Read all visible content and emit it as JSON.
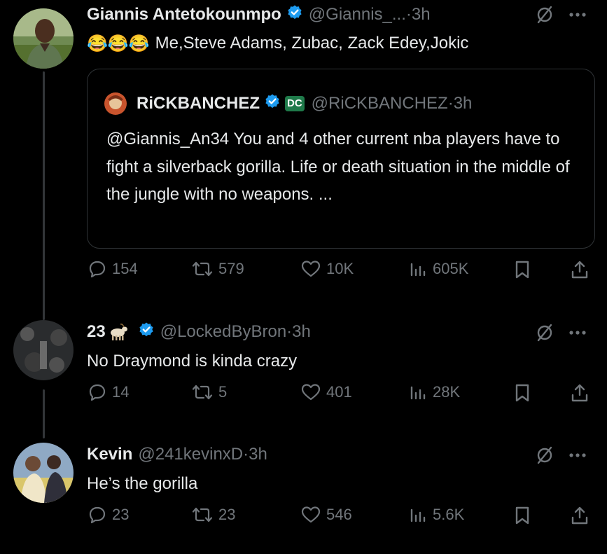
{
  "colors": {
    "background": "#000000",
    "text": "#e7e9ea",
    "secondary": "#71767b",
    "verified": "#1d9bf0",
    "divider": "#2f3336"
  },
  "main_post": {
    "name": "Giannis Antetokounmpo",
    "handle": "@Giannis_...",
    "time": "·3h",
    "emojis": "😂😂😂",
    "text": "Me,Steve Adams, Zubac, Zack Edey,Jokic",
    "quote": {
      "name": "RiCKBANCHEZ",
      "badge": "DC",
      "handle": "@RiCKBANCHEZ",
      "time": "·3h",
      "text": "@Giannis_An34 You and 4 other current nba players have to fight a silverback gorilla. Life or death situation in the middle of the jungle with no weapons. ..."
    },
    "stats": {
      "replies": "154",
      "reposts": "579",
      "likes": "10K",
      "views": "605K"
    }
  },
  "replies": [
    {
      "name": "23",
      "handle": "@LockedByBron",
      "time": "·3h",
      "text": "No Draymond is kinda crazy",
      "stats": {
        "replies": "14",
        "reposts": "5",
        "likes": "401",
        "views": "28K"
      }
    },
    {
      "name": "Kevin",
      "handle": "@241kevinxD",
      "time": "·3h",
      "text": "He’s the gorilla",
      "stats": {
        "replies": "23",
        "reposts": "23",
        "likes": "546",
        "views": "5.6K"
      }
    }
  ],
  "icons": {
    "reply": "comment-icon",
    "repost": "repost-icon",
    "like": "heart-icon",
    "views": "analytics-icon",
    "bookmark": "bookmark-icon",
    "share": "share-icon",
    "grok": "slashed-circle-icon",
    "more": "more-icon",
    "goat_emoji": "goat-emoji-icon"
  }
}
